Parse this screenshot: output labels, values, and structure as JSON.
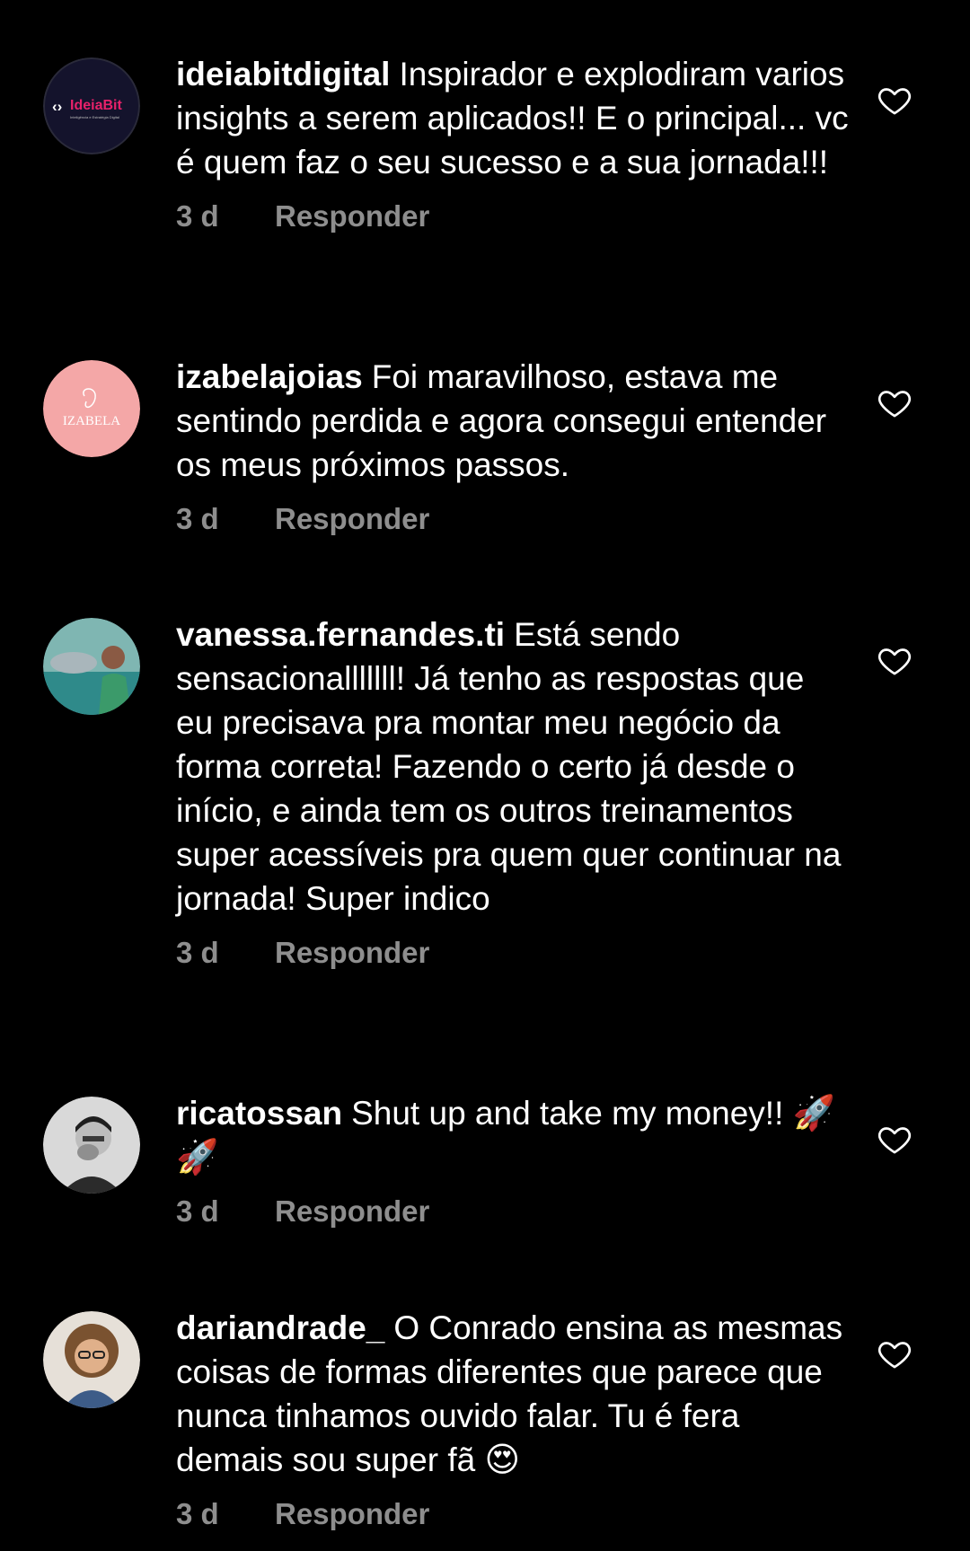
{
  "comments": [
    {
      "username": "ideiabitdigital",
      "text": "Inspirador e explodiram varios insights a serem aplicados!! E o principal... vc é quem faz o seu sucesso e a sua jornada!!!",
      "time": "3 d",
      "reply_label": "Responder",
      "avatar_logo_text": "IdeiaBit",
      "avatar_sub_text": "Inteligência e Estratégia Digital"
    },
    {
      "username": "izabelajoias",
      "text": "Foi maravilhoso, estava me sentindo perdida e agora consegui entender os meus próximos passos.",
      "time": "3 d",
      "reply_label": "Responder",
      "avatar_logo_text": "IZABELA"
    },
    {
      "username": "vanessa.fernandes.ti",
      "text": "Está sendo sensacionalllllll! Já tenho as respostas que eu precisava pra montar meu negócio da forma correta! Fazendo o certo já desde o início, e ainda tem os outros treinamentos super acessíveis pra quem quer continuar na jornada! Super indico",
      "time": "3 d",
      "reply_label": "Responder"
    },
    {
      "username": "ricatossan",
      "text": "Shut up and take my money!!",
      "emoji": "🚀🚀",
      "time": "3 d",
      "reply_label": "Responder"
    },
    {
      "username": "dariandrade_",
      "text": "O Conrado ensina as mesmas coisas de formas diferentes que parece que nunca tinhamos ouvido falar. Tu é fera demais sou super fã",
      "emoji": "😍",
      "time": "3 d",
      "reply_label": "Responder"
    }
  ],
  "icons": {
    "like": "heart-outline-icon"
  },
  "colors": {
    "background": "#000000",
    "text": "#ffffff",
    "meta": "#8e8e8e"
  }
}
